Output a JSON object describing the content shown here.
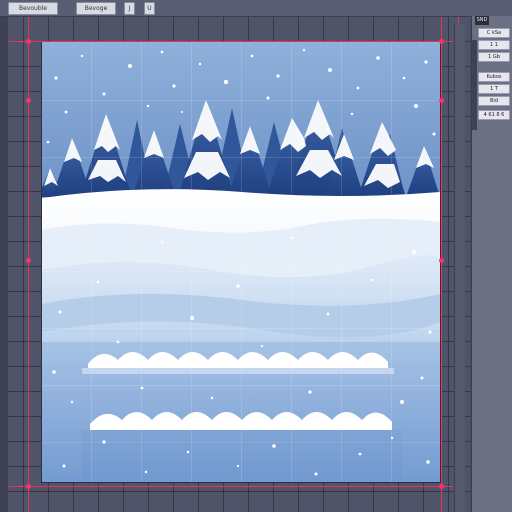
{
  "toolbar": {
    "button1_label": "Bevouble",
    "button2_label": "Bevoge",
    "button3_label": "J",
    "button4_label": "U"
  },
  "panel": {
    "header": "SND",
    "buttons": [
      {
        "label": "C kSa"
      },
      {
        "label": "1 1"
      },
      {
        "label": "1 Gb"
      },
      {
        "label": "Kubos"
      },
      {
        "label": "1 T"
      },
      {
        "label": "Bid"
      },
      {
        "label": "4 61 8 6"
      }
    ]
  },
  "colors": {
    "guide": "#e8305a",
    "accent": "#ff2f6e",
    "sky_top": "#8fb0da",
    "snow": "#ffffff"
  }
}
